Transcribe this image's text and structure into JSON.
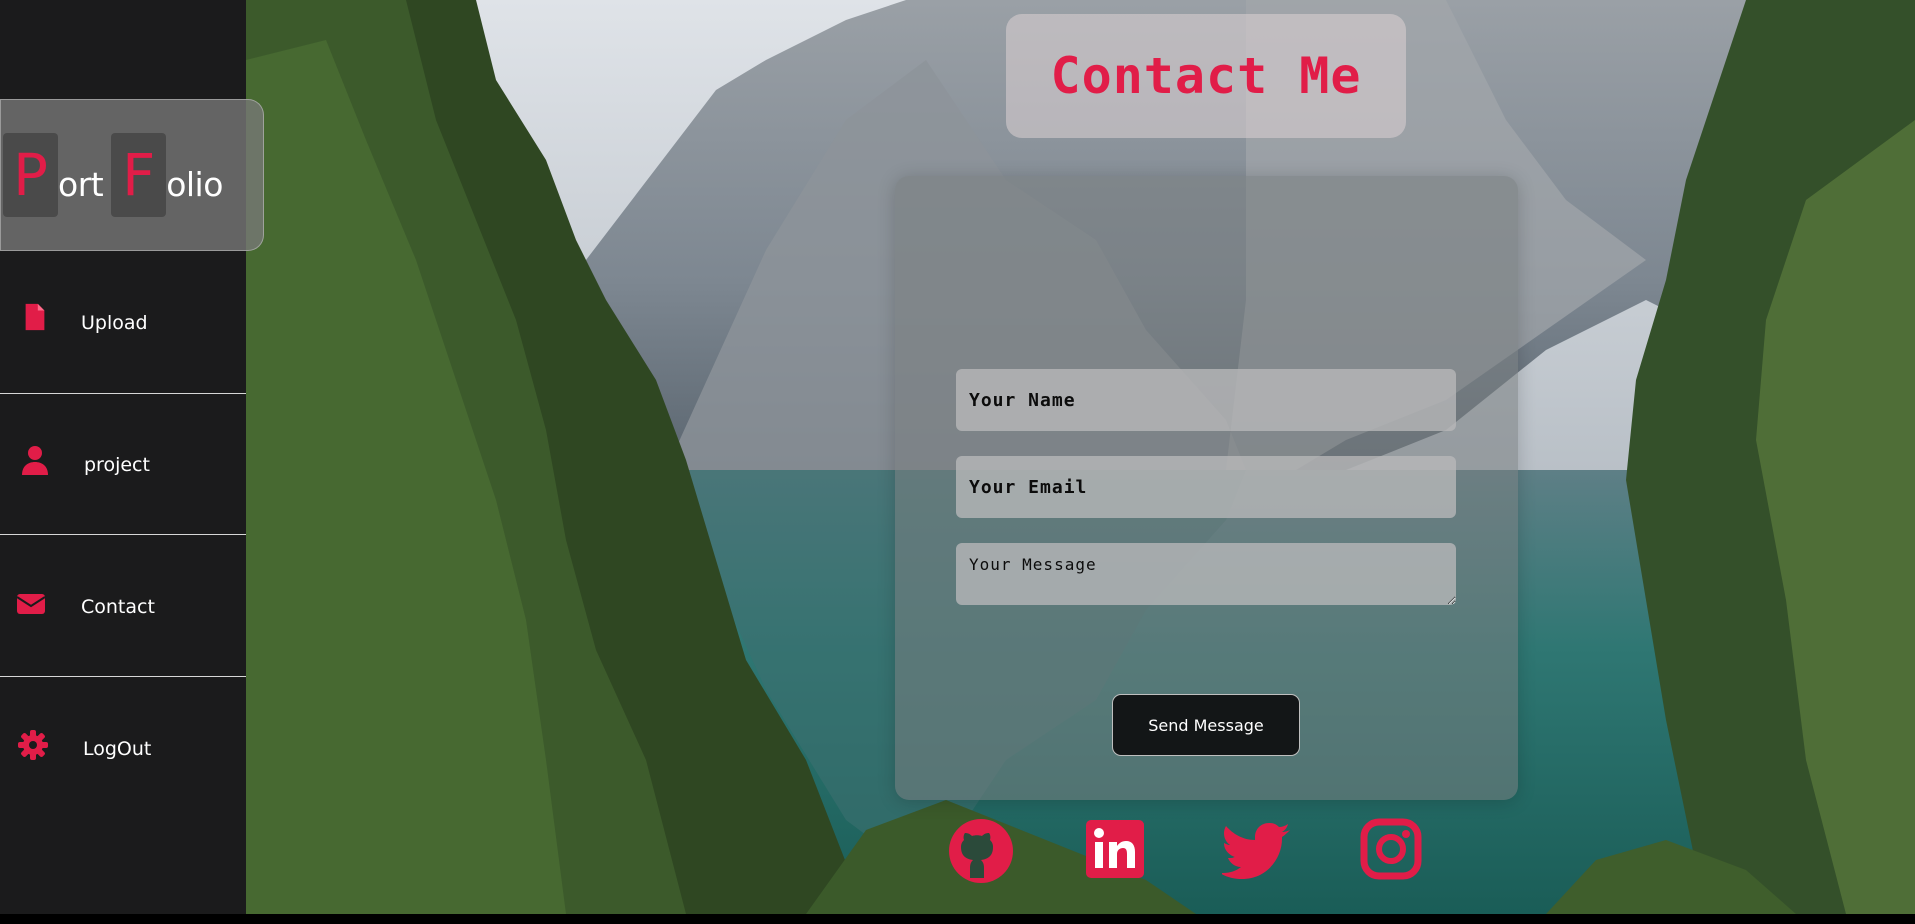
{
  "brand": {
    "cap1": "P",
    "rest1": "ort",
    "cap2": "F",
    "rest2": "olio"
  },
  "nav": [
    {
      "label": "Upload",
      "icon": "file-icon"
    },
    {
      "label": "project",
      "icon": "user-icon"
    },
    {
      "label": "Contact",
      "icon": "envelope-icon"
    },
    {
      "label": "LogOut",
      "icon": "gear-icon"
    }
  ],
  "page": {
    "title": "Contact Me"
  },
  "form": {
    "name_placeholder": "Your Name",
    "email_placeholder": "Your Email",
    "message_placeholder": "Your Message",
    "submit_label": "Send Message"
  },
  "social": [
    {
      "icon": "github-icon"
    },
    {
      "icon": "linkedin-icon"
    },
    {
      "icon": "twitter-icon"
    },
    {
      "icon": "instagram-icon"
    }
  ],
  "colors": {
    "accent": "#e11d48",
    "sidebar_bg": "#1b1b1c",
    "button_bg": "#131617"
  }
}
